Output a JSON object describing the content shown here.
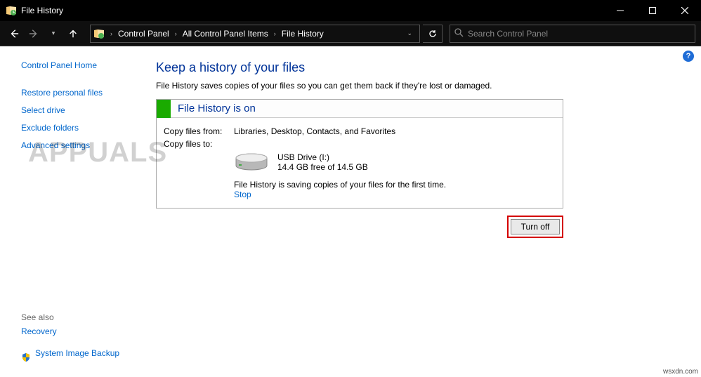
{
  "titlebar": {
    "title": "File History"
  },
  "breadcrumbs": [
    "Control Panel",
    "All Control Panel Items",
    "File History"
  ],
  "search": {
    "placeholder": "Search Control Panel"
  },
  "sidebar": {
    "home": "Control Panel Home",
    "links": [
      "Restore personal files",
      "Select drive",
      "Exclude folders",
      "Advanced settings"
    ],
    "see_also_label": "See also",
    "footer_links": [
      "Recovery",
      "System Image Backup"
    ]
  },
  "main": {
    "heading": "Keep a history of your files",
    "description": "File History saves copies of your files so you can get them back if they're lost or damaged.",
    "panel_title": "File History is on",
    "copy_from_label": "Copy files from:",
    "copy_from_value": "Libraries, Desktop, Contacts, and Favorites",
    "copy_to_label": "Copy files to:",
    "drive_name": "USB Drive (I:)",
    "drive_space": "14.4 GB free of 14.5 GB",
    "status_text": "File History is saving copies of your files for the first time.",
    "stop_label": "Stop",
    "turn_off_label": "Turn off"
  },
  "watermark": {
    "brand": "APPUALS",
    "source": "wsxdn.com"
  },
  "help": "?"
}
